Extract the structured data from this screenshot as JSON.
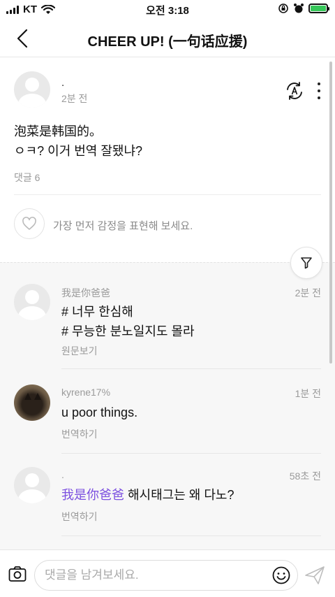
{
  "status_bar": {
    "carrier": "KT",
    "time": "오전 3:18"
  },
  "nav": {
    "title": "CHEER UP! (一句话应援)"
  },
  "post": {
    "author": ".",
    "time": "2분 전",
    "body_line1": "泡菜是韩国的。",
    "body_line2": "ㅇㅋ? 이거 번역 잘됐냐?",
    "comment_count": "댓글 6",
    "like_prompt": "가장 먼저 감정을 표현해 보세요."
  },
  "comments": [
    {
      "author": "我是你爸爸",
      "time": "2분 전",
      "line1": "# 너무 한심해",
      "line2": "# 무능한 분노일지도 몰라",
      "action": "원문보기"
    },
    {
      "author": "kyrene17%",
      "time": "1분 전",
      "line1": "u poor things.",
      "action": "번역하기"
    },
    {
      "author": ".",
      "time": "58초 전",
      "mention": "我是你爸爸",
      "line1_rest": " 해시태그는 왜 다노?",
      "action": "번역하기"
    }
  ],
  "input": {
    "placeholder": "댓글을 남겨보세요.",
    "value": ""
  },
  "colors": {
    "mention": "#7b4fe0",
    "battery": "#36c759",
    "comments_bg": "#f7f7f7"
  },
  "icons": {
    "back": "chevron-left-icon",
    "translate": "translate-icon",
    "more": "more-vertical-icon",
    "like": "heart-icon",
    "filter": "filter-icon",
    "camera": "camera-icon",
    "emoji": "smiley-icon",
    "send": "send-icon"
  }
}
